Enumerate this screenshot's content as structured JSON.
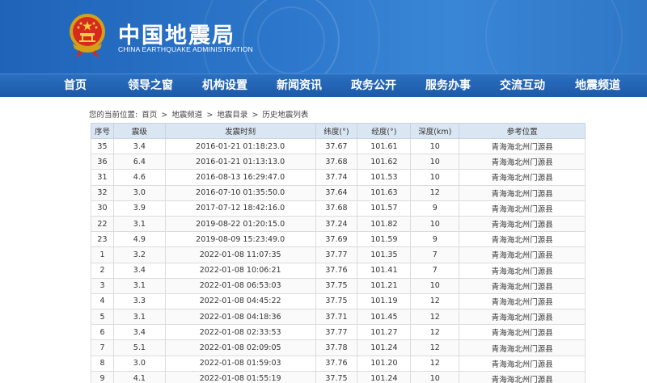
{
  "header": {
    "title": "中国地震局",
    "subtitle": "CHINA EARTHQUAKE ADMINISTRATION"
  },
  "nav": {
    "items": [
      {
        "label": "首页"
      },
      {
        "label": "领导之窗"
      },
      {
        "label": "机构设置"
      },
      {
        "label": "新闻资讯"
      },
      {
        "label": "政务公开"
      },
      {
        "label": "服务办事"
      },
      {
        "label": "交流互动"
      },
      {
        "label": "地震频道"
      }
    ]
  },
  "breadcrumb": {
    "prefix": "您的当前位置:",
    "items": [
      "首页",
      "地震频道",
      "地震目录",
      "历史地震列表"
    ],
    "separator": ">"
  },
  "table": {
    "columns": [
      "序号",
      "震级",
      "发震时刻",
      "纬度(°)",
      "经度(°)",
      "深度(km)",
      "参考位置"
    ],
    "rows": [
      [
        "35",
        "3.4",
        "2016-01-21 01:18:23.0",
        "37.67",
        "101.61",
        "10",
        "青海海北州门源县"
      ],
      [
        "36",
        "6.4",
        "2016-01-21 01:13:13.0",
        "37.68",
        "101.62",
        "10",
        "青海海北州门源县"
      ],
      [
        "31",
        "4.6",
        "2016-08-13 16:29:47.0",
        "37.74",
        "101.53",
        "10",
        "青海海北州门源县"
      ],
      [
        "32",
        "3.0",
        "2016-07-10 01:35:50.0",
        "37.64",
        "101.63",
        "12",
        "青海海北州门源县"
      ],
      [
        "30",
        "3.9",
        "2017-07-12 18:42:16.0",
        "37.68",
        "101.57",
        "9",
        "青海海北州门源县"
      ],
      [
        "22",
        "3.1",
        "2019-08-22 01:20:15.0",
        "37.24",
        "101.82",
        "10",
        "青海海北州门源县"
      ],
      [
        "23",
        "4.9",
        "2019-08-09 15:23:49.0",
        "37.69",
        "101.59",
        "9",
        "青海海北州门源县"
      ],
      [
        "1",
        "3.2",
        "2022-01-08 11:07:35",
        "37.77",
        "101.35",
        "7",
        "青海海北州门源县"
      ],
      [
        "2",
        "3.4",
        "2022-01-08 10:06:21",
        "37.76",
        "101.41",
        "7",
        "青海海北州门源县"
      ],
      [
        "3",
        "3.1",
        "2022-01-08 06:53:03",
        "37.75",
        "101.21",
        "10",
        "青海海北州门源县"
      ],
      [
        "4",
        "3.3",
        "2022-01-08 04:45:22",
        "37.75",
        "101.19",
        "12",
        "青海海北州门源县"
      ],
      [
        "5",
        "3.1",
        "2022-01-08 04:18:36",
        "37.71",
        "101.45",
        "12",
        "青海海北州门源县"
      ],
      [
        "6",
        "3.4",
        "2022-01-08 02:33:53",
        "37.77",
        "101.27",
        "12",
        "青海海北州门源县"
      ],
      [
        "7",
        "5.1",
        "2022-01-08 02:09:05",
        "37.78",
        "101.24",
        "12",
        "青海海北州门源县"
      ],
      [
        "8",
        "3.0",
        "2022-01-08 01:59:03",
        "37.76",
        "101.20",
        "12",
        "青海海北州门源县"
      ],
      [
        "9",
        "4.1",
        "2022-01-08 01:55:19",
        "37.75",
        "101.24",
        "10",
        "青海海北州门源县"
      ]
    ]
  },
  "colors": {
    "header_blue": "#2d78cc",
    "nav_blue": "#1d5aa8",
    "table_header_bg": "#dbe6f3"
  },
  "icons": {
    "logo": "national-emblem-icon"
  }
}
